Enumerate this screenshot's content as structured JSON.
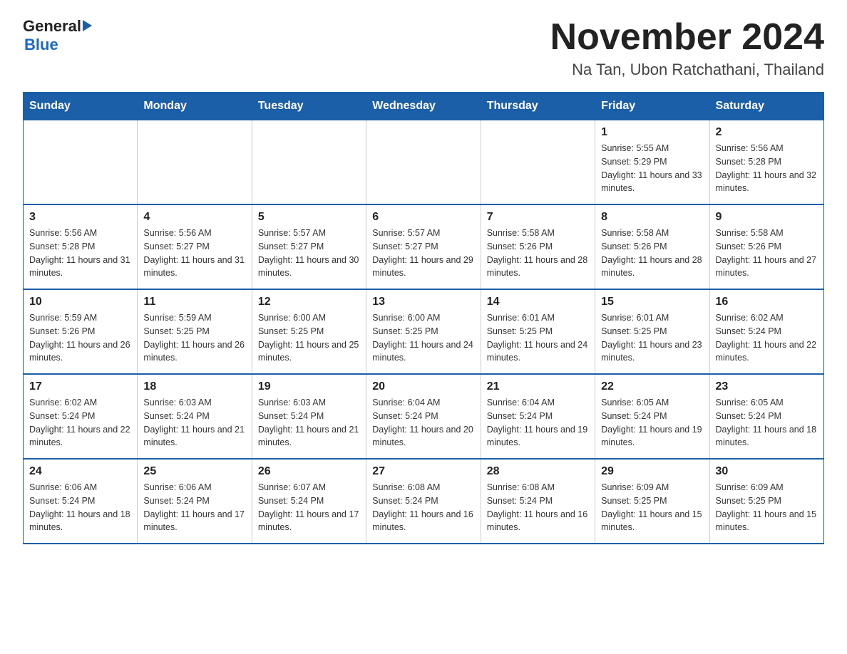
{
  "header": {
    "logo_general": "General",
    "logo_blue": "Blue",
    "month_title": "November 2024",
    "subtitle": "Na Tan, Ubon Ratchathani, Thailand"
  },
  "weekdays": [
    "Sunday",
    "Monday",
    "Tuesday",
    "Wednesday",
    "Thursday",
    "Friday",
    "Saturday"
  ],
  "weeks": [
    [
      {
        "day": "",
        "info": ""
      },
      {
        "day": "",
        "info": ""
      },
      {
        "day": "",
        "info": ""
      },
      {
        "day": "",
        "info": ""
      },
      {
        "day": "",
        "info": ""
      },
      {
        "day": "1",
        "info": "Sunrise: 5:55 AM\nSunset: 5:29 PM\nDaylight: 11 hours and 33 minutes."
      },
      {
        "day": "2",
        "info": "Sunrise: 5:56 AM\nSunset: 5:28 PM\nDaylight: 11 hours and 32 minutes."
      }
    ],
    [
      {
        "day": "3",
        "info": "Sunrise: 5:56 AM\nSunset: 5:28 PM\nDaylight: 11 hours and 31 minutes."
      },
      {
        "day": "4",
        "info": "Sunrise: 5:56 AM\nSunset: 5:27 PM\nDaylight: 11 hours and 31 minutes."
      },
      {
        "day": "5",
        "info": "Sunrise: 5:57 AM\nSunset: 5:27 PM\nDaylight: 11 hours and 30 minutes."
      },
      {
        "day": "6",
        "info": "Sunrise: 5:57 AM\nSunset: 5:27 PM\nDaylight: 11 hours and 29 minutes."
      },
      {
        "day": "7",
        "info": "Sunrise: 5:58 AM\nSunset: 5:26 PM\nDaylight: 11 hours and 28 minutes."
      },
      {
        "day": "8",
        "info": "Sunrise: 5:58 AM\nSunset: 5:26 PM\nDaylight: 11 hours and 28 minutes."
      },
      {
        "day": "9",
        "info": "Sunrise: 5:58 AM\nSunset: 5:26 PM\nDaylight: 11 hours and 27 minutes."
      }
    ],
    [
      {
        "day": "10",
        "info": "Sunrise: 5:59 AM\nSunset: 5:26 PM\nDaylight: 11 hours and 26 minutes."
      },
      {
        "day": "11",
        "info": "Sunrise: 5:59 AM\nSunset: 5:25 PM\nDaylight: 11 hours and 26 minutes."
      },
      {
        "day": "12",
        "info": "Sunrise: 6:00 AM\nSunset: 5:25 PM\nDaylight: 11 hours and 25 minutes."
      },
      {
        "day": "13",
        "info": "Sunrise: 6:00 AM\nSunset: 5:25 PM\nDaylight: 11 hours and 24 minutes."
      },
      {
        "day": "14",
        "info": "Sunrise: 6:01 AM\nSunset: 5:25 PM\nDaylight: 11 hours and 24 minutes."
      },
      {
        "day": "15",
        "info": "Sunrise: 6:01 AM\nSunset: 5:25 PM\nDaylight: 11 hours and 23 minutes."
      },
      {
        "day": "16",
        "info": "Sunrise: 6:02 AM\nSunset: 5:24 PM\nDaylight: 11 hours and 22 minutes."
      }
    ],
    [
      {
        "day": "17",
        "info": "Sunrise: 6:02 AM\nSunset: 5:24 PM\nDaylight: 11 hours and 22 minutes."
      },
      {
        "day": "18",
        "info": "Sunrise: 6:03 AM\nSunset: 5:24 PM\nDaylight: 11 hours and 21 minutes."
      },
      {
        "day": "19",
        "info": "Sunrise: 6:03 AM\nSunset: 5:24 PM\nDaylight: 11 hours and 21 minutes."
      },
      {
        "day": "20",
        "info": "Sunrise: 6:04 AM\nSunset: 5:24 PM\nDaylight: 11 hours and 20 minutes."
      },
      {
        "day": "21",
        "info": "Sunrise: 6:04 AM\nSunset: 5:24 PM\nDaylight: 11 hours and 19 minutes."
      },
      {
        "day": "22",
        "info": "Sunrise: 6:05 AM\nSunset: 5:24 PM\nDaylight: 11 hours and 19 minutes."
      },
      {
        "day": "23",
        "info": "Sunrise: 6:05 AM\nSunset: 5:24 PM\nDaylight: 11 hours and 18 minutes."
      }
    ],
    [
      {
        "day": "24",
        "info": "Sunrise: 6:06 AM\nSunset: 5:24 PM\nDaylight: 11 hours and 18 minutes."
      },
      {
        "day": "25",
        "info": "Sunrise: 6:06 AM\nSunset: 5:24 PM\nDaylight: 11 hours and 17 minutes."
      },
      {
        "day": "26",
        "info": "Sunrise: 6:07 AM\nSunset: 5:24 PM\nDaylight: 11 hours and 17 minutes."
      },
      {
        "day": "27",
        "info": "Sunrise: 6:08 AM\nSunset: 5:24 PM\nDaylight: 11 hours and 16 minutes."
      },
      {
        "day": "28",
        "info": "Sunrise: 6:08 AM\nSunset: 5:24 PM\nDaylight: 11 hours and 16 minutes."
      },
      {
        "day": "29",
        "info": "Sunrise: 6:09 AM\nSunset: 5:25 PM\nDaylight: 11 hours and 15 minutes."
      },
      {
        "day": "30",
        "info": "Sunrise: 6:09 AM\nSunset: 5:25 PM\nDaylight: 11 hours and 15 minutes."
      }
    ]
  ]
}
